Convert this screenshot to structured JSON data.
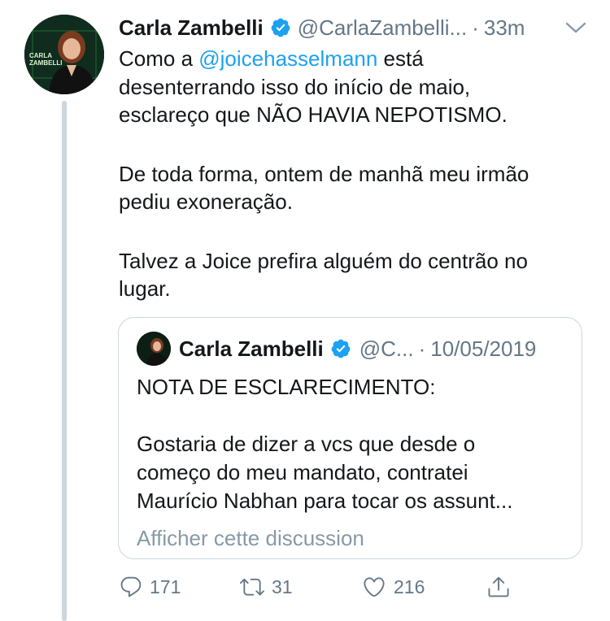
{
  "tweet": {
    "author_name": "Carla Zambelli",
    "handle": "@CarlaZambelli...",
    "separator": "·",
    "time": "33m",
    "text_prefix": "Como a ",
    "mention": "@joicehasselmann",
    "text_after_mention": " está",
    "line2": "desenterrando isso do início de maio,",
    "line3": "esclareço que NÃO HAVIA NEPOTISMO.",
    "para2_line1": "De toda forma, ontem de manhã meu irmão",
    "para2_line2": "pediu exoneração.",
    "para3_line1": "Talvez a Joice prefira alguém do centrão no",
    "para3_line2": "lugar.",
    "avatar_text": "CARLA ZAMBELLI"
  },
  "quoted": {
    "author_name": "Carla Zambelli",
    "handle": "@C...",
    "separator": "·",
    "date": "10/05/2019",
    "line1": "NOTA DE ESCLARECIMENTO:",
    "line2": "Gostaria de dizer a vcs que desde o",
    "line3": "começo do meu mandato, contratei",
    "line4": "Maurício Nabhan para tocar os assunt...",
    "show_thread": "Afficher cette discussion"
  },
  "actions": {
    "replies": "171",
    "retweets": "31",
    "likes": "216"
  },
  "colors": {
    "link": "#1da1f2",
    "muted": "#657786",
    "verified": "#1da1f2",
    "thread_line": "#ccd6dd"
  }
}
